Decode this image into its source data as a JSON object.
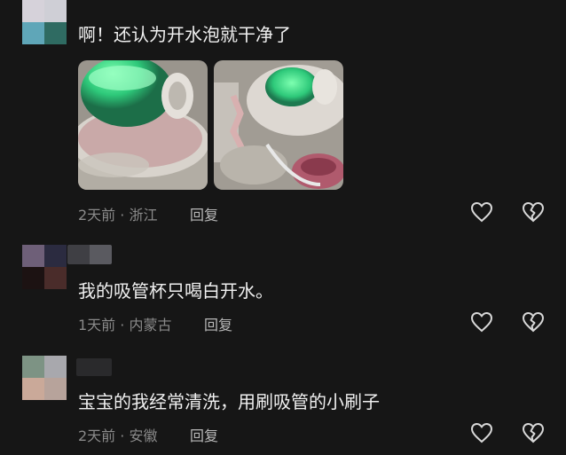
{
  "comments": [
    {
      "text": "啊！还认为开水泡就干净了",
      "time": "2天前",
      "location": "浙江",
      "reply_label": "回复",
      "has_photos": true
    },
    {
      "text": "我的吸管杯只喝白开水。",
      "time": "1天前",
      "location": "内蒙古",
      "reply_label": "回复",
      "has_photos": false
    },
    {
      "text": "宝宝的我经常清洗，用刷吸管的小刷子",
      "time": "2天前",
      "location": "安徽",
      "reply_label": "回复",
      "has_photos": false
    }
  ],
  "meta_separator": " · ",
  "icons": {
    "like": "heart-outline-icon",
    "dislike": "broken-heart-outline-icon"
  },
  "colors": {
    "background": "#161616",
    "text": "#f0f0f0",
    "meta": "#8a8a8a",
    "icon": "#d8d8d8"
  }
}
